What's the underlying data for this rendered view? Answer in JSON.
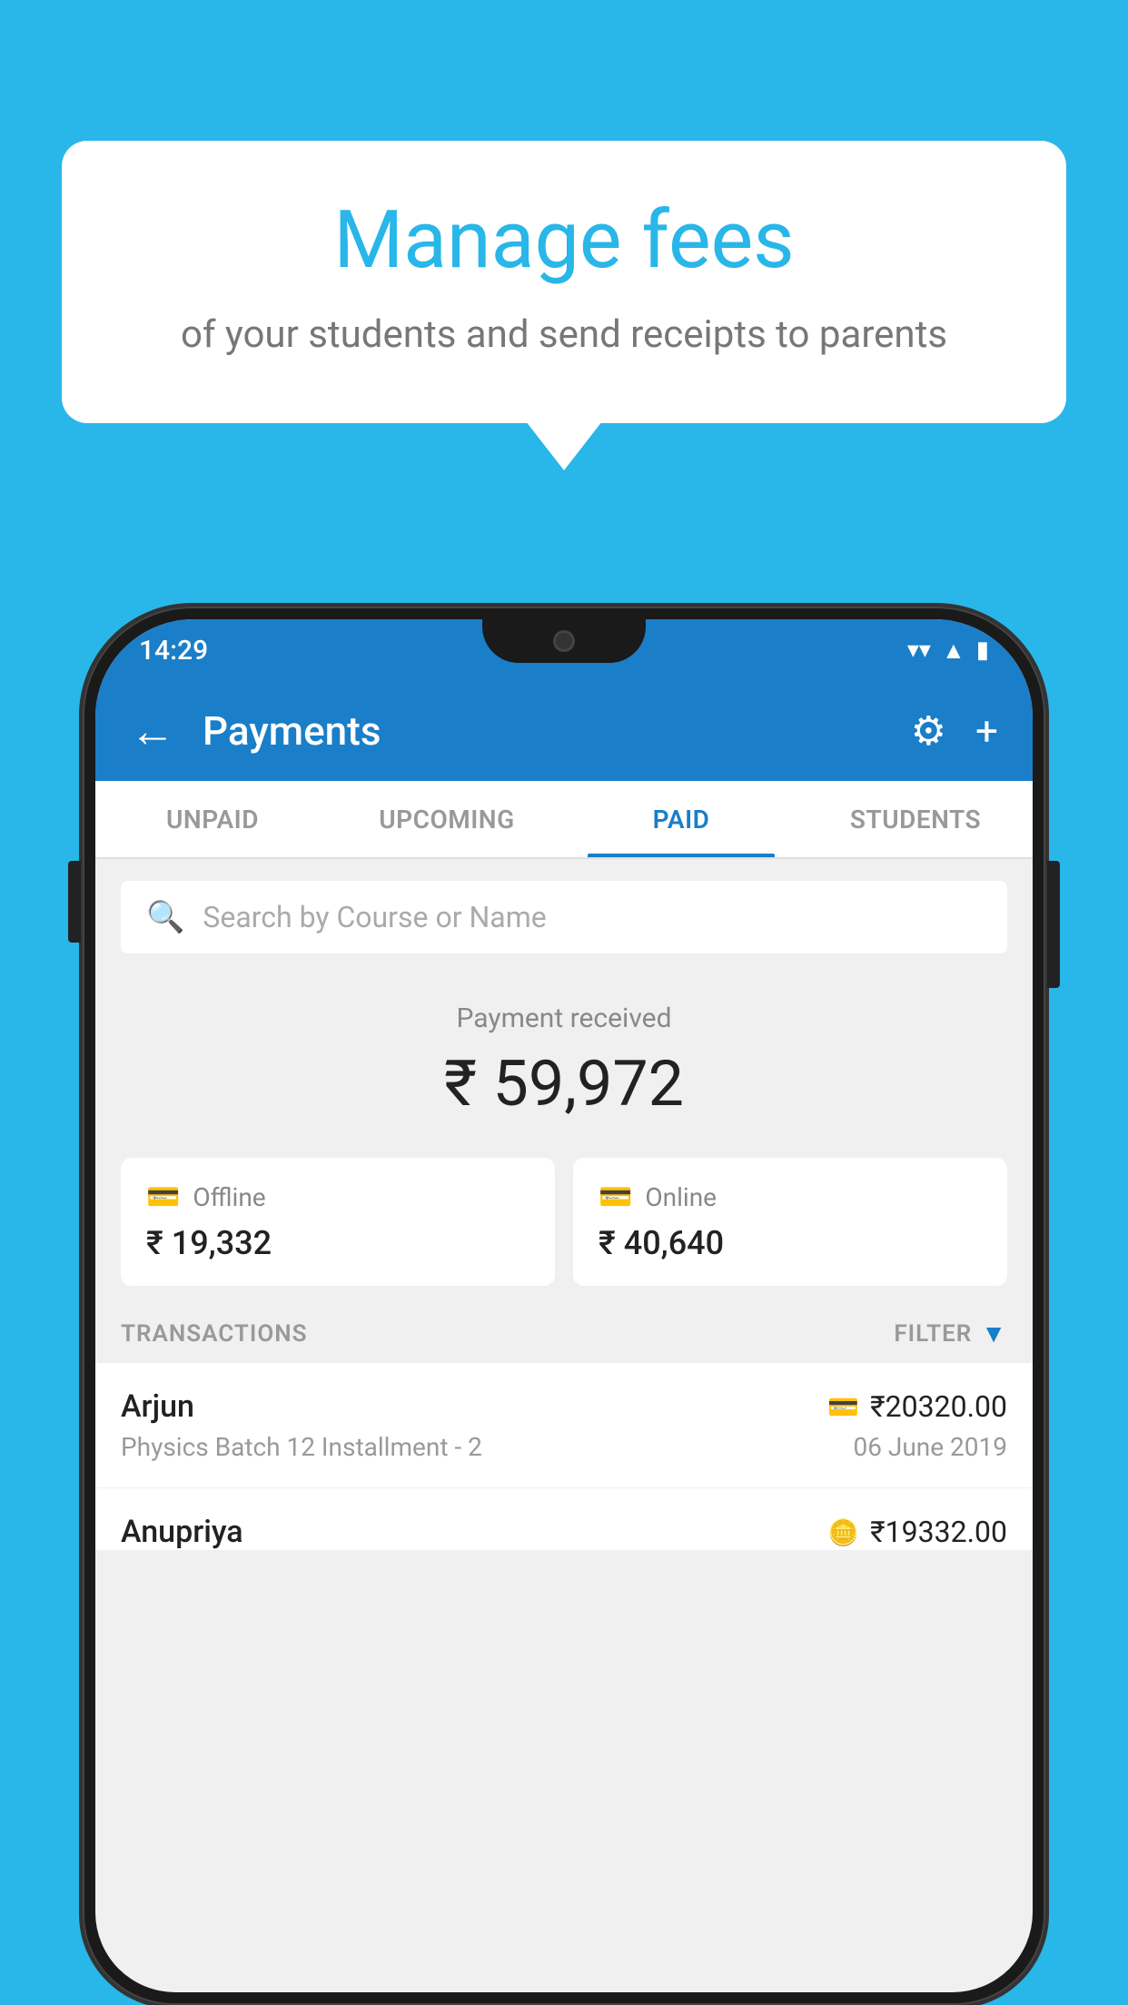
{
  "background_color": "#29b6e8",
  "bubble": {
    "title": "Manage fees",
    "subtitle": "of your students and send receipts to parents"
  },
  "status_bar": {
    "time": "14:29",
    "wifi_icon": "▼",
    "signal_icon": "▲",
    "battery_icon": "▮"
  },
  "app_bar": {
    "title": "Payments",
    "back_label": "←",
    "gear_label": "⚙",
    "plus_label": "+"
  },
  "tabs": [
    {
      "label": "UNPAID",
      "active": false
    },
    {
      "label": "UPCOMING",
      "active": false
    },
    {
      "label": "PAID",
      "active": true
    },
    {
      "label": "STUDENTS",
      "active": false
    }
  ],
  "search": {
    "placeholder": "Search by Course or Name"
  },
  "payment_summary": {
    "label": "Payment received",
    "amount": "₹ 59,972",
    "offline_label": "Offline",
    "offline_amount": "₹ 19,332",
    "online_label": "Online",
    "online_amount": "₹ 40,640"
  },
  "transactions": {
    "header_label": "TRANSACTIONS",
    "filter_label": "FILTER",
    "items": [
      {
        "name": "Arjun",
        "amount": "₹20320.00",
        "mode": "card",
        "course": "Physics Batch 12 Installment - 2",
        "date": "06 June 2019"
      },
      {
        "name": "Anupriya",
        "amount": "₹19332.00",
        "mode": "cash",
        "course": "",
        "date": ""
      }
    ]
  }
}
